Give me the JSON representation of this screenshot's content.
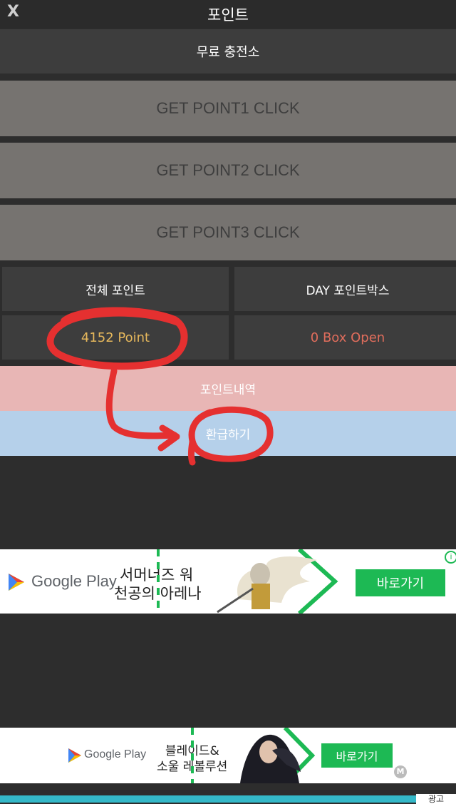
{
  "header": {
    "close_label": "X",
    "title": "포인트"
  },
  "free_charge": "무료 충전소",
  "get_point_buttons": [
    "GET POINT1 CLICK",
    "GET POINT2 CLICK",
    "GET POINT3 CLICK"
  ],
  "stats": {
    "total_label": "전체 포인트",
    "day_box_label": "DAY 포인트박스",
    "total_value": "4152 Point",
    "box_value": "0 Box Open"
  },
  "point_history_label": "포인트내역",
  "refund_label": "환급하기",
  "ad_top": {
    "store": "Google Play",
    "headline_line1": "서머너즈 워",
    "headline_line2": "천공의 아레나",
    "cta": "바로가기",
    "info": "i"
  },
  "ad_bottom": {
    "store": "Google Play",
    "headline_line1": "블레이드&",
    "headline_line2": "소울 레볼루션",
    "cta": "바로가기",
    "badge": "M",
    "corner_label": "광고"
  },
  "colors": {
    "points_value": "#e6b85c",
    "box_value": "#e06d5c",
    "annotation": "#e53030",
    "cta_green": "#1db954"
  },
  "icons": {
    "close": "close-icon",
    "play_store": "google-play-icon",
    "info": "info-icon",
    "ad_badge": "ad-network-badge-icon"
  }
}
